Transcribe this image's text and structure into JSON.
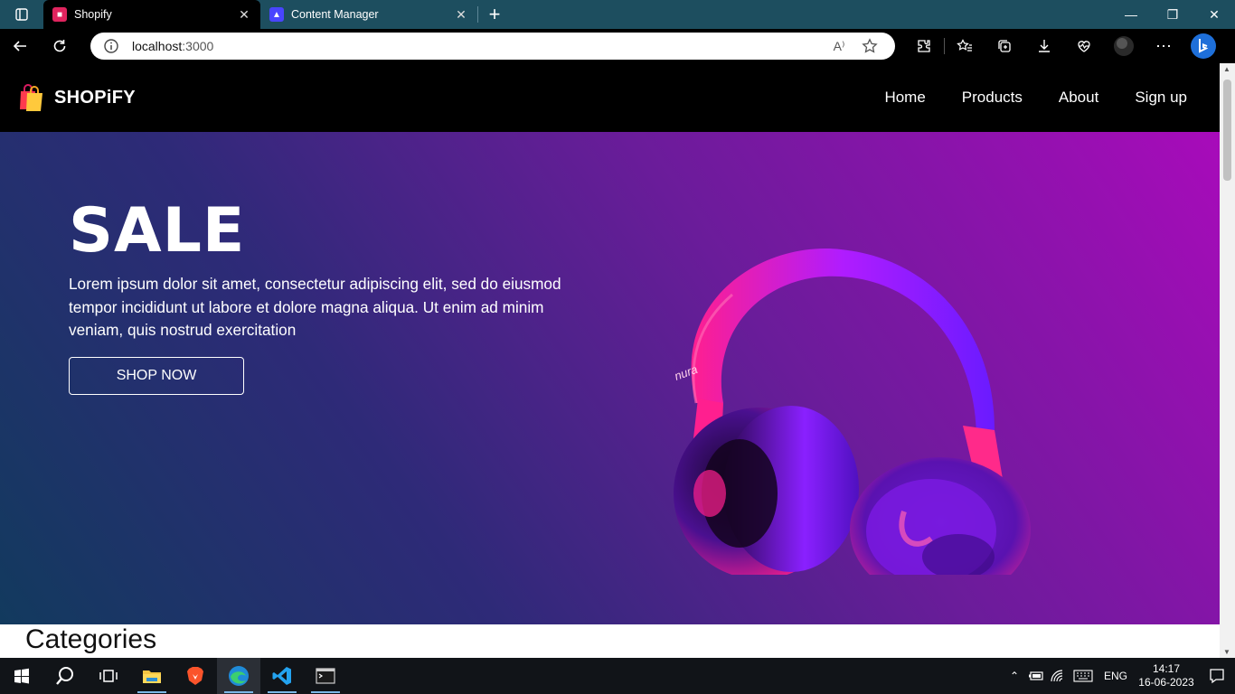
{
  "browser": {
    "tabs": [
      {
        "title": "Shopify",
        "icon": "shopify-favicon",
        "active": true
      },
      {
        "title": "Content Manager",
        "icon": "strapi-favicon",
        "active": false
      }
    ],
    "url_host": "localhost",
    "url_port": ":3000",
    "read_aloud_label": "A⁾"
  },
  "site": {
    "brand": "SHOPiFY",
    "nav": [
      "Home",
      "Products",
      "About",
      "Sign up"
    ],
    "hero": {
      "title": "SALE",
      "text": "Lorem ipsum dolor sit amet, consectetur adipiscing elit, sed do eiusmod tempor incididunt ut labore et dolore magna aliqua. Ut enim ad minim veniam, quis nostrud exercitation",
      "button": "SHOP NOW",
      "image_text": "nura"
    },
    "next_section_title": "Categories"
  },
  "taskbar": {
    "apps": [
      "windows-start-icon",
      "search-icon",
      "task-view-icon",
      "file-explorer-icon",
      "brave-icon",
      "edge-icon",
      "vscode-icon",
      "terminal-icon"
    ],
    "language": "ENG",
    "time": "14:17",
    "date": "16-06-2023"
  },
  "colors": {
    "tabstrip": "#1d4e5f",
    "hero_start": "#123a5e",
    "hero_end": "#a80bba",
    "headphone_pink": "#ff1f8f",
    "headphone_purple": "#7a12f0"
  }
}
